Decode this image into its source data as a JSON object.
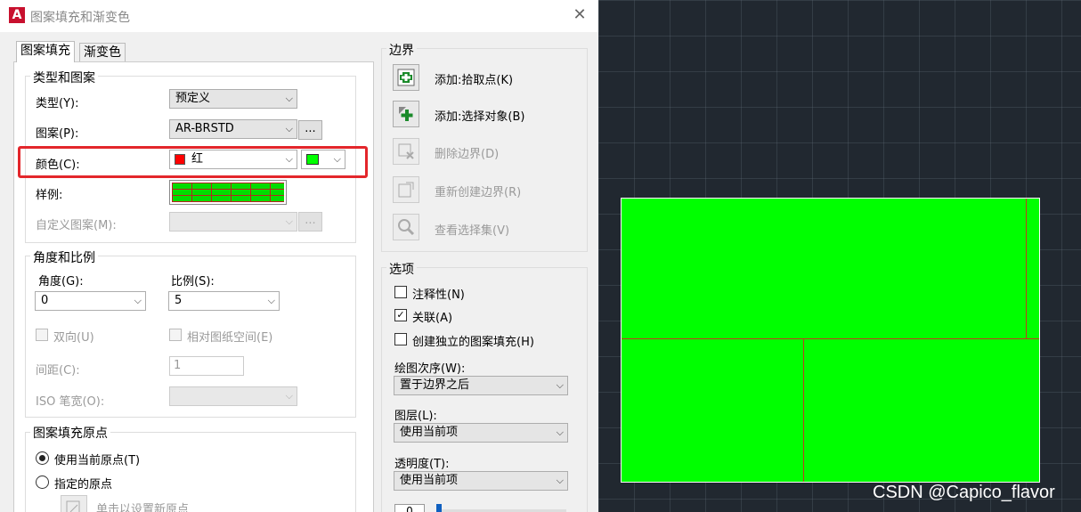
{
  "window": {
    "app_icon": "A",
    "title": "图案填充和渐变色",
    "close_icon": "✕"
  },
  "tabs": [
    "图案填充",
    "渐变色"
  ],
  "type_pattern": {
    "title": "类型和图案",
    "type_label": "类型(Y):",
    "type_value": "预定义",
    "pattern_label": "图案(P):",
    "pattern_value": "AR-BRSTD",
    "browse": "...",
    "color_label": "颜色(C):",
    "color_value": "红",
    "color_swatch": "#ff0000",
    "bg_color_swatch": "#00ff00",
    "sample_label": "样例:",
    "custom_label": "自定义图案(M):",
    "custom_value": "",
    "browse2": "..."
  },
  "angle_scale": {
    "title": "角度和比例",
    "angle_label": "角度(G):",
    "angle_value": "0",
    "scale_label": "比例(S):",
    "scale_value": "5",
    "double_label": "双向(U)",
    "relative_label": "相对图纸空间(E)",
    "spacing_label": "间距(C):",
    "spacing_value": "1",
    "iso_label": "ISO 笔宽(O):",
    "iso_value": ""
  },
  "origin": {
    "title": "图案填充原点",
    "use_current": "使用当前原点(T)",
    "specified": "指定的原点",
    "click_set": "单击以设置新原点"
  },
  "boundaries": {
    "title": "边界",
    "add_pick": "添加:拾取点(K)",
    "add_select": "添加:选择对象(B)",
    "remove": "删除边界(D)",
    "recreate": "重新创建边界(R)",
    "view_selection": "查看选择集(V)"
  },
  "options": {
    "title": "选项",
    "annotative": "注释性(N)",
    "associative": "关联(A)",
    "associative_checked": true,
    "independent": "创建独立的图案填充(H)",
    "draw_order_label": "绘图次序(W):",
    "draw_order_value": "置于边界之后",
    "layer_label": "图层(L):",
    "layer_value": "使用当前项",
    "transparency_label": "透明度(T):",
    "transparency_value": "使用当前项",
    "transparency_number": "0"
  },
  "watermark": "CSDN @Capico_flavor"
}
